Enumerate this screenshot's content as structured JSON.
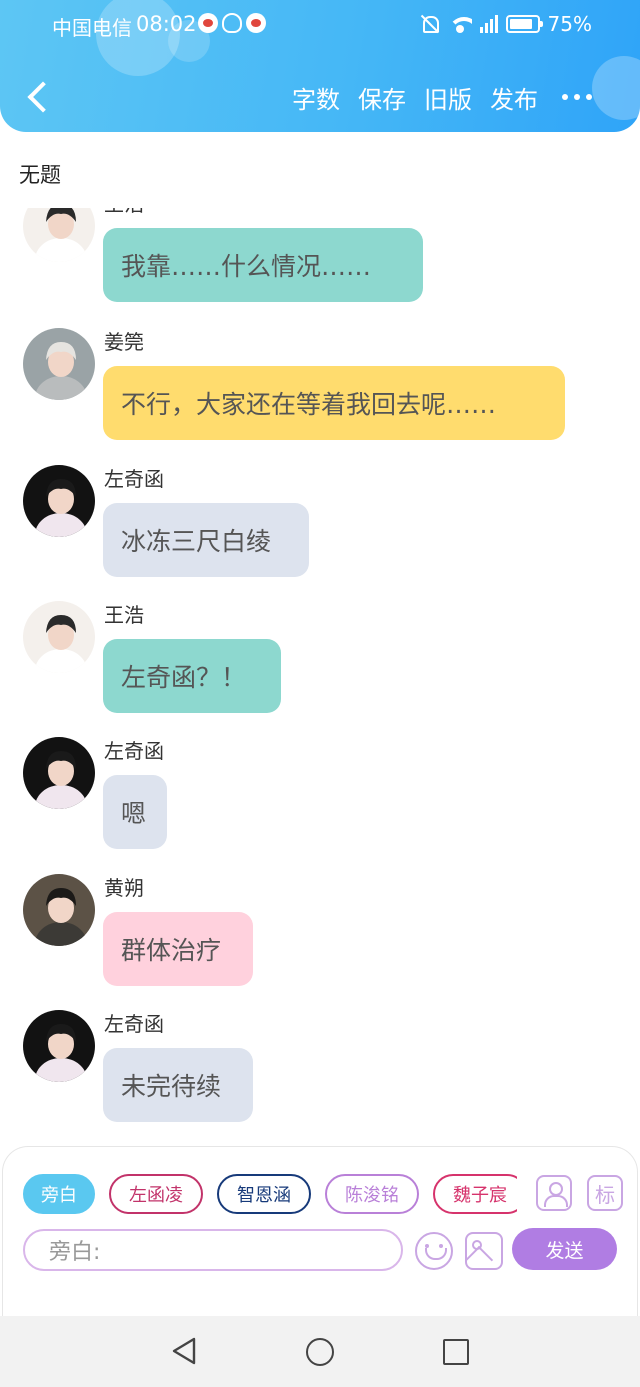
{
  "status_bar": {
    "carrier": "中国电信",
    "time": "08:02",
    "battery": "75%",
    "app_icons": [
      "weibo-icon",
      "qq-icon",
      "weibo-icon"
    ]
  },
  "toolbar": {
    "back_icon": "chevron-left-icon",
    "actions": [
      "字数",
      "保存",
      "旧版",
      "发布"
    ],
    "more_icon": "more-dots-icon"
  },
  "story": {
    "title": "无题",
    "messages": [
      {
        "sender": "王浩",
        "text": "我靠……什么情况……",
        "bubble_color": "#8dd8cf",
        "avatar_bg": "#f4f0ec",
        "avatar_hair": "#2a2a2a",
        "avatar_shirt": "#ffffff"
      },
      {
        "sender": "姜筦",
        "text": "不行，大家还在等着我回去呢……",
        "bubble_color": "#ffdc6e",
        "avatar_bg": "#9aa3a6",
        "avatar_hair": "#e6e4e0",
        "avatar_shirt": "#b9bcbd"
      },
      {
        "sender": "左奇函",
        "text": "冰冻三尺白绫",
        "bubble_color": "#dde3ee",
        "avatar_bg": "#121212",
        "avatar_hair": "#1a1a1a",
        "avatar_shirt": "#f0e6ee"
      },
      {
        "sender": "王浩",
        "text": "左奇函？！",
        "bubble_color": "#8dd8cf",
        "avatar_bg": "#f4f0ec",
        "avatar_hair": "#2a2a2a",
        "avatar_shirt": "#ffffff"
      },
      {
        "sender": "左奇函",
        "text": "嗯",
        "bubble_color": "#dde3ee",
        "avatar_bg": "#121212",
        "avatar_hair": "#1a1a1a",
        "avatar_shirt": "#f0e6ee"
      },
      {
        "sender": "黄朔",
        "text": "群体治疗",
        "bubble_color": "#ffd1dd",
        "avatar_bg": "#5c5246",
        "avatar_hair": "#1c1a18",
        "avatar_shirt": "#3c3a36"
      },
      {
        "sender": "左奇函",
        "text": "未完待续",
        "bubble_color": "#dde3ee",
        "avatar_bg": "#121212",
        "avatar_hair": "#1a1a1a",
        "avatar_shirt": "#f0e6ee"
      }
    ]
  },
  "composer": {
    "roles": [
      {
        "label": "旁白",
        "active": true,
        "color": "#5ac8f0"
      },
      {
        "label": "左函凌",
        "active": false,
        "color": "#c2336a"
      },
      {
        "label": "智恩涵",
        "active": false,
        "color": "#173a7a"
      },
      {
        "label": "陈浚铭",
        "active": false,
        "color": "#b980d8"
      },
      {
        "label": "魏子宸",
        "active": false,
        "color": "#d6336c"
      }
    ],
    "role_manager_icon": "person-icon",
    "tag_label": "标",
    "input_placeholder": "旁白:",
    "emoji_icon": "smile-icon",
    "image_icon": "image-icon",
    "send_label": "发送"
  },
  "nav_bar": {
    "icons": [
      "triangle-back-icon",
      "circle-home-icon",
      "square-recents-icon"
    ]
  }
}
